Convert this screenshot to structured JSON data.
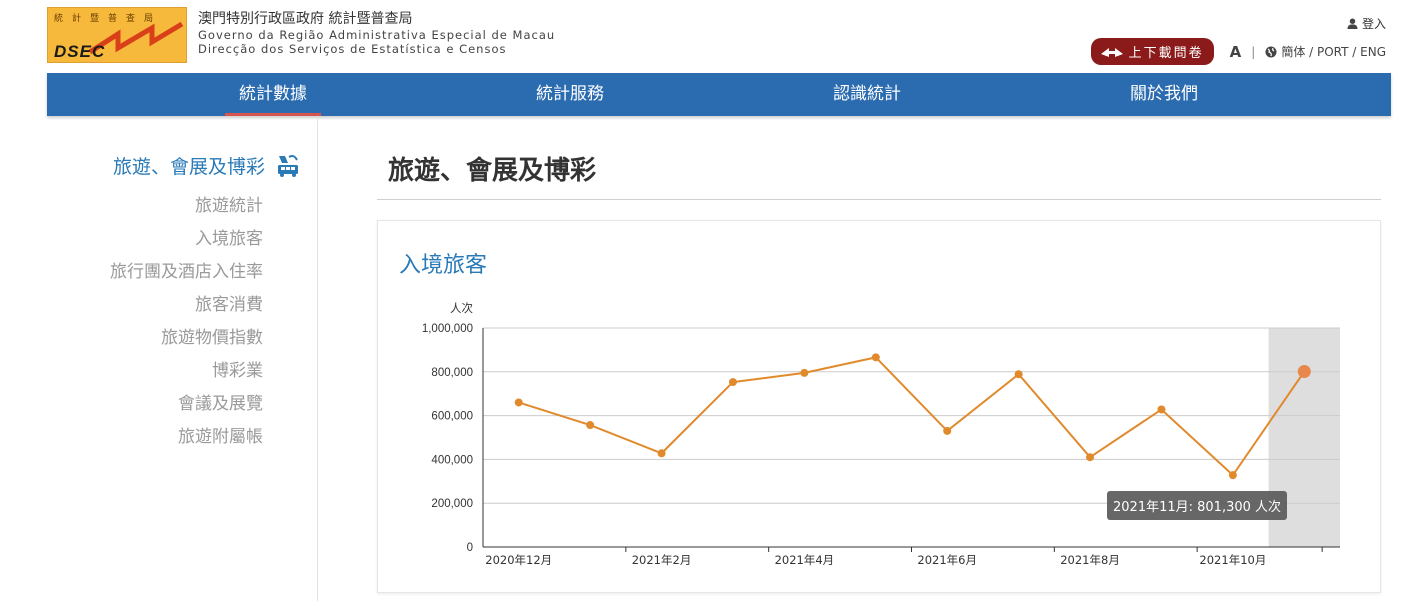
{
  "header": {
    "logo_top": "統計暨普查局",
    "logo_abbr": "DSEC",
    "org_zh": "澳門特別行政區政府 統計暨普查局",
    "org_pt1": "Governo da Região Administrativa Especial de Macau",
    "org_pt2": "Direcção dos Serviços de Estatística e Censos",
    "login_label": "登入",
    "survey_label": "上下載問卷",
    "font_size_label": "A",
    "separator": "|",
    "lang_label": "簡体 / PORT / ENG"
  },
  "nav": {
    "items": [
      {
        "label": "統計數據"
      },
      {
        "label": "統計服務"
      },
      {
        "label": "認識統計"
      },
      {
        "label": "關於我們"
      }
    ]
  },
  "sidebar": {
    "title": "旅遊、會展及博彩",
    "links": [
      {
        "label": "旅遊統計"
      },
      {
        "label": "入境旅客"
      },
      {
        "label": "旅行團及酒店入住率"
      },
      {
        "label": "旅客消費"
      },
      {
        "label": "旅遊物價指數"
      },
      {
        "label": "博彩業"
      },
      {
        "label": "會議及展覽"
      },
      {
        "label": "旅遊附屬帳"
      }
    ]
  },
  "main": {
    "title": "旅遊、會展及博彩",
    "card_title": "入境旅客"
  },
  "tooltip": "2021年11月: 801,300 人次",
  "chart_data": {
    "type": "line",
    "ylabel": "人次",
    "ylim": [
      0,
      1000000
    ],
    "y_ticks": [
      "0",
      "200,000",
      "400,000",
      "600,000",
      "800,000",
      "1,000,000"
    ],
    "y_tick_values": [
      0,
      200000,
      400000,
      600000,
      800000,
      1000000
    ],
    "categories": [
      "2020年12月",
      "2021年1月",
      "2021年2月",
      "2021年3月",
      "2021年4月",
      "2021年5月",
      "2021年6月",
      "2021年7月",
      "2021年8月",
      "2021年9月",
      "2021年10月",
      "2021年11月"
    ],
    "x_tick_labels": [
      "2020年12月",
      "",
      "2021年2月",
      "",
      "2021年4月",
      "",
      "2021年6月",
      "",
      "2021年8月",
      "",
      "2021年10月",
      ""
    ],
    "values": [
      660000,
      557000,
      428000,
      753000,
      795000,
      866000,
      530000,
      789000,
      410000,
      628000,
      328000,
      801300
    ],
    "highlighted_index": 11,
    "line_color": "#e08a2c",
    "highlight_band_color": "#dedede",
    "grid": true
  }
}
